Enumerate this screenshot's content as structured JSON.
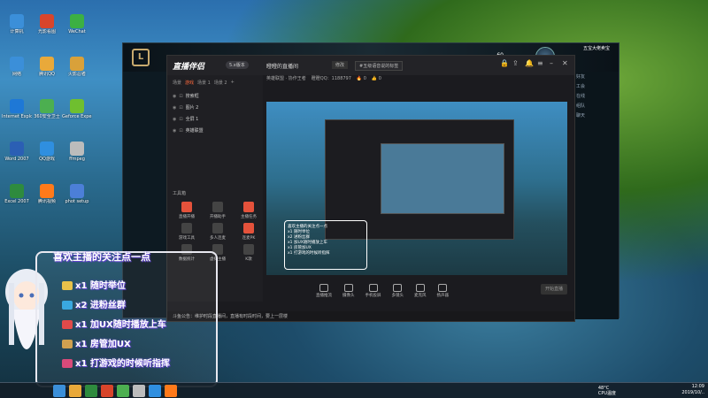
{
  "desktop": {
    "icons": [
      {
        "label": "计算机",
        "color": "#3b8fd9"
      },
      {
        "label": "网络",
        "color": "#3b8fd9"
      },
      {
        "label": "Internet Explorer",
        "color": "#1e78d6"
      },
      {
        "label": "Word 2007",
        "color": "#2b5fb4"
      },
      {
        "label": "Excel 2007",
        "color": "#2e8b3e"
      },
      {
        "label": "光影看图",
        "color": "#d8452b"
      },
      {
        "label": "腾讯QQ",
        "color": "#e9a93a"
      },
      {
        "label": "360安全卫士",
        "color": "#4caf50"
      },
      {
        "label": "QQ游戏",
        "color": "#2f8fe0"
      },
      {
        "label": "腾讯视频",
        "color": "#ff7a1a"
      },
      {
        "label": "WeChat",
        "color": "#3cb043"
      },
      {
        "label": "火影忍者",
        "color": "#d9a13a"
      },
      {
        "label": "Geforce Experience",
        "color": "#6fbf2f"
      },
      {
        "label": "ffmpeg",
        "color": "#bcbcbc"
      },
      {
        "label": "phot setup",
        "color": "#4c7fd8"
      }
    ]
  },
  "game_window": {
    "logo": "L",
    "level": "60",
    "user": "五宝大佬卖宝",
    "side_rows": [
      "好友",
      "工会",
      "在线",
      "组队",
      "聊天"
    ]
  },
  "app": {
    "logo": "直播伴侣",
    "version": "5.x版本",
    "room_title": "瞪瞪的直播间",
    "edit_label": "修改",
    "tag": "#五级语音说的标签",
    "subbar": [
      "英雄联盟 · 协作王者",
      "瞪瞪QQ：1188797",
      "🔥 0",
      "👍 0"
    ],
    "scene_tabs": [
      "场景",
      "游戏",
      "场景 1",
      "场景 2",
      "+"
    ],
    "sources": [
      "搜索框",
      "图片 2",
      "全屏 1",
      "英雄联盟"
    ],
    "toolbox_title": "工具箱",
    "tools": [
      {
        "label": "直播开播",
        "red": true
      },
      {
        "label": "开播助手",
        "red": false
      },
      {
        "label": "主播任务",
        "red": true
      },
      {
        "label": "游戏工具",
        "red": false
      },
      {
        "label": "多人连麦",
        "red": false
      },
      {
        "label": "连麦PK",
        "red": true
      },
      {
        "label": "数据统计",
        "red": false
      },
      {
        "label": "虚拟主播",
        "red": false
      },
      {
        "label": "K歌",
        "red": false
      }
    ],
    "bottom_tools": [
      "直播推流",
      "摄像头",
      "手机投屏",
      "多镜头",
      "麦克风",
      "扬声器"
    ],
    "start_label": "开始直播",
    "notice": "斗鱼公告：维护时段直播间，直播有时段时间，要上一层楼"
  },
  "preview": {
    "follow_lines": [
      "喜欢主播的关注点一点",
      "x1 随时举位",
      "x2 进粉丝群",
      "x1 加UX随时播放上车",
      "x1 房管加UX",
      "x1 打游戏的时候听指挥"
    ]
  },
  "overlay": {
    "title": "喜欢主播的关注点一点",
    "rewards": [
      {
        "text": "x1 随时举位",
        "color": "#e8c24a"
      },
      {
        "text": "x2 进粉丝群",
        "color": "#3aa8e0"
      },
      {
        "text": "x1 加UX随时播放上车",
        "color": "#e04a4a"
      },
      {
        "text": "x1 房管加UX",
        "color": "#d0a050"
      },
      {
        "text": "x1 打游戏的时候听指挥",
        "color": "#d84a7a"
      }
    ]
  },
  "taskbar": {
    "icons": [
      "#3b8fd9",
      "#e9a93a",
      "#2e8b3e",
      "#d8452b",
      "#4caf50",
      "#bcbcbc",
      "#2f8fe0",
      "#ff7a1a"
    ],
    "temp": "48°C",
    "cpu": "CPU温度",
    "time": "12:09",
    "date": "2019/10/.."
  }
}
